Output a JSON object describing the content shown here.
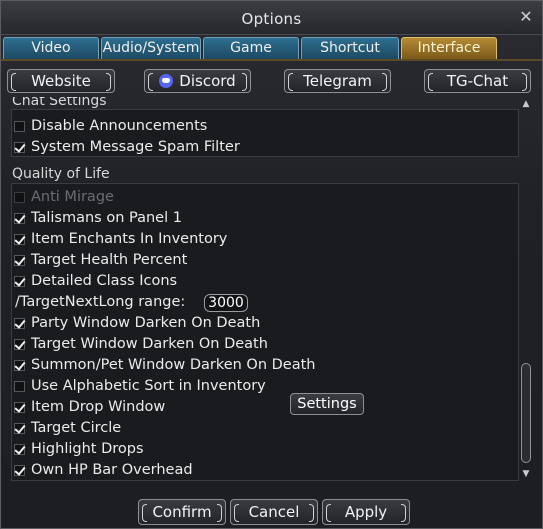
{
  "window": {
    "title": "Options",
    "close_glyph": "✕"
  },
  "tabs": [
    {
      "label": "Video",
      "active": false
    },
    {
      "label": "Audio/System",
      "active": false
    },
    {
      "label": "Game",
      "active": false
    },
    {
      "label": "Shortcut",
      "active": false
    },
    {
      "label": "Interface",
      "active": true
    }
  ],
  "links": {
    "website": "Website",
    "discord": "Discord",
    "telegram": "Telegram",
    "tgchat": "TG-Chat"
  },
  "chat_settings": {
    "heading": "Chat Settings",
    "items": [
      {
        "label": "Disable Announcements",
        "checked": false
      },
      {
        "label": "System Message Spam Filter",
        "checked": true
      }
    ]
  },
  "quality_of_life": {
    "heading": "Quality of Life",
    "items": [
      {
        "label": "Anti Mirage",
        "checked": false,
        "disabled": true
      },
      {
        "label": "Talismans on Panel 1",
        "checked": true
      },
      {
        "label": "Item Enchants In Inventory",
        "checked": true
      },
      {
        "label": "Target Health Percent",
        "checked": true
      },
      {
        "label": "Detailed Class Icons",
        "checked": true
      },
      {
        "label": "/TargetNextLong range:",
        "value": "3000"
      },
      {
        "label": "Party Window Darken On Death",
        "checked": true
      },
      {
        "label": "Target Window Darken On Death",
        "checked": true
      },
      {
        "label": "Summon/Pet Window Darken On Death",
        "checked": true
      },
      {
        "label": "Use Alphabetic Sort in Inventory",
        "checked": false
      },
      {
        "label": "Item Drop Window",
        "checked": true
      },
      {
        "label": "Target Circle",
        "checked": true
      },
      {
        "label": "Highlight Drops",
        "checked": true
      },
      {
        "label": "Own HP Bar Overhead",
        "checked": true
      }
    ],
    "settings_button": "Settings"
  },
  "footer": {
    "confirm": "Confirm",
    "cancel": "Cancel",
    "apply": "Apply"
  }
}
